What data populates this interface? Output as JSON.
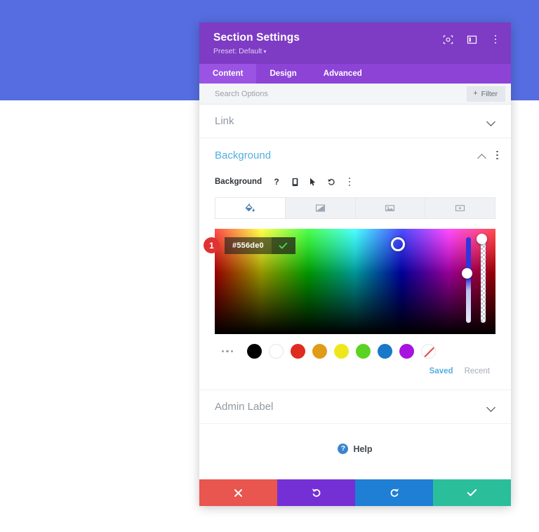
{
  "page": {
    "background_color": "#556de0"
  },
  "modal": {
    "header": {
      "title": "Section Settings",
      "preset_label": "Preset: Default",
      "preset_caret": "▾",
      "icons": [
        "focus-target-icon",
        "layout-panel-icon",
        "overflow-menu-icon"
      ]
    },
    "tabs": [
      {
        "label": "Content",
        "active": true
      },
      {
        "label": "Design",
        "active": false
      },
      {
        "label": "Advanced",
        "active": false
      }
    ],
    "search": {
      "placeholder": "Search Options",
      "value": "",
      "filter_label": "Filter",
      "filter_plus": "+"
    },
    "sections": {
      "link": {
        "label": "Link",
        "state": "collapsed"
      },
      "background": {
        "label": "Background",
        "state": "expanded",
        "accent_color": "#55AEE0",
        "field_label": "Background",
        "field_icons": [
          "help-icon",
          "responsive-mobile-icon",
          "hover-cursor-icon",
          "reset-undo-icon",
          "option-menu-icon"
        ],
        "type_tabs": [
          {
            "name": "color",
            "icon": "paint-bucket-icon",
            "active": true
          },
          {
            "name": "gradient",
            "icon": "gradient-icon",
            "active": false
          },
          {
            "name": "image",
            "icon": "image-icon",
            "active": false
          },
          {
            "name": "video",
            "icon": "video-icon",
            "active": false
          }
        ],
        "color_picker": {
          "hex_value": "#556de0",
          "confirm_icon": "checkmark-icon",
          "badge_number": "1",
          "hue_slider_label": "hue-slider",
          "alpha_slider_label": "alpha-slider"
        },
        "swatches": [
          {
            "name": "more",
            "color": ""
          },
          {
            "name": "black",
            "color": "#000000"
          },
          {
            "name": "white",
            "color": "#FFFFFF"
          },
          {
            "name": "red",
            "color": "#E02B20"
          },
          {
            "name": "orange",
            "color": "#E09B17"
          },
          {
            "name": "yellow",
            "color": "#EDE81B"
          },
          {
            "name": "green",
            "color": "#5BD322"
          },
          {
            "name": "blue",
            "color": "#1878C9"
          },
          {
            "name": "purple",
            "color": "#A813E0"
          },
          {
            "name": "transparent",
            "color": ""
          }
        ],
        "palette_tabs": [
          {
            "label": "Saved",
            "active": true
          },
          {
            "label": "Recent",
            "active": false
          }
        ]
      },
      "admin_label": {
        "label": "Admin Label",
        "state": "collapsed"
      }
    },
    "help": {
      "label": "Help",
      "icon": "help-circle-icon"
    },
    "footer": [
      {
        "name": "cancel-button",
        "icon": "close-x-icon",
        "color": "#E9554F"
      },
      {
        "name": "undo-button",
        "icon": "undo-arrow-icon",
        "color": "#7430D4"
      },
      {
        "name": "redo-button",
        "icon": "redo-arrow-icon",
        "color": "#1E7FD4"
      },
      {
        "name": "save-button",
        "icon": "checkmark-icon",
        "color": "#2BBE9B"
      }
    ]
  }
}
